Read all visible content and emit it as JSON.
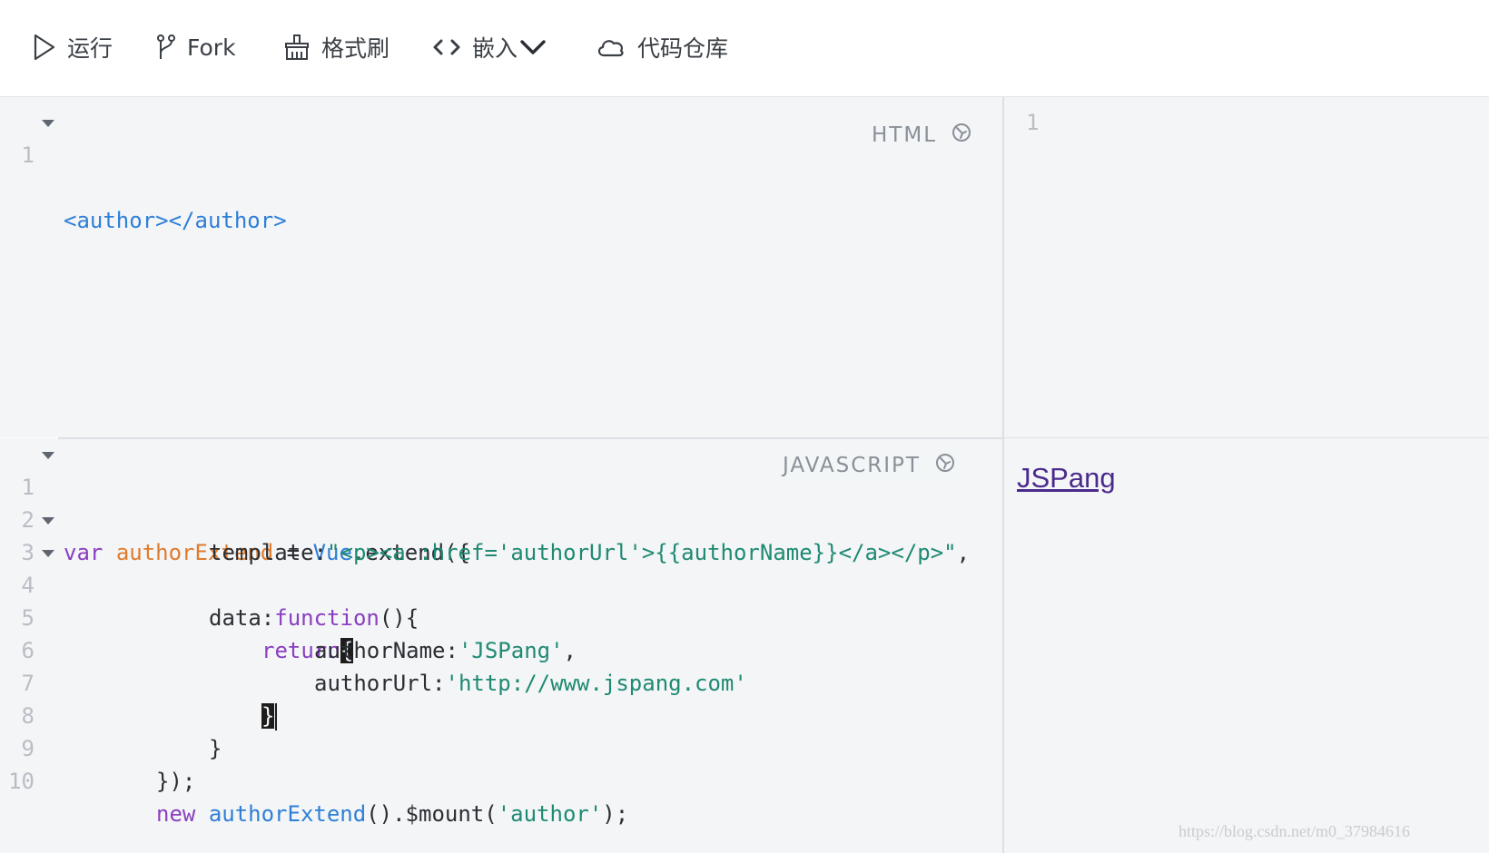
{
  "toolbar": {
    "run": {
      "label": "运行",
      "icon": "play-icon"
    },
    "fork": {
      "label": "Fork",
      "icon": "fork-icon"
    },
    "format": {
      "label": "格式刷",
      "icon": "brush-icon"
    },
    "embed": {
      "label": "嵌入",
      "icon": "code-brackets-icon",
      "chevron": "chevron-down-icon"
    },
    "repo": {
      "label": "代码仓库",
      "icon": "cloud-icon"
    }
  },
  "html_editor": {
    "language": "HTML",
    "lines": [
      {
        "n": "1",
        "code": "<author></author>"
      }
    ]
  },
  "js_editor": {
    "language": "JAVASCRIPT",
    "line_numbers": [
      "1",
      "2",
      "3",
      "4",
      "5",
      "6",
      "7",
      "8",
      "9",
      "10"
    ],
    "code": {
      "l1_kw": "var",
      "l1_var": "authorExtend",
      "l1_op": " = ",
      "l1_vue": "Vue",
      "l1_rest": ".extend({",
      "l2_key": "template:",
      "l2_str": "\"<p><a :href='authorUrl'>{{authorName}}</a></p>\"",
      "l2_end": ",",
      "l3_key": "data:",
      "l3_kw": "function",
      "l3_rest": "(){",
      "l4_kw": "return",
      "l4_brace": "{",
      "l5_key": "authorName:",
      "l5_str": "'JSPang'",
      "l5_end": ",",
      "l6_key": "authorUrl:",
      "l6_str": "'http://www.jspang.com'",
      "l7_brace": "}",
      "l8_brace": "}",
      "l9": "});",
      "l10_kw": "new",
      "l10_fn": "authorExtend",
      "l10_mid": "().$mount(",
      "l10_str": "'author'",
      "l10_end": ");"
    }
  },
  "preview": {
    "line_number": "1",
    "link_text": "JSPang"
  },
  "watermark": "https://blog.csdn.net/m0_37984616",
  "colors": {
    "editor_bg": "#f3f5f7",
    "keyword": "#8a3fc0",
    "variable": "#e07b2e",
    "function": "#2f7fd6",
    "string": "#1f8a73",
    "link": "#4b2a8c"
  }
}
